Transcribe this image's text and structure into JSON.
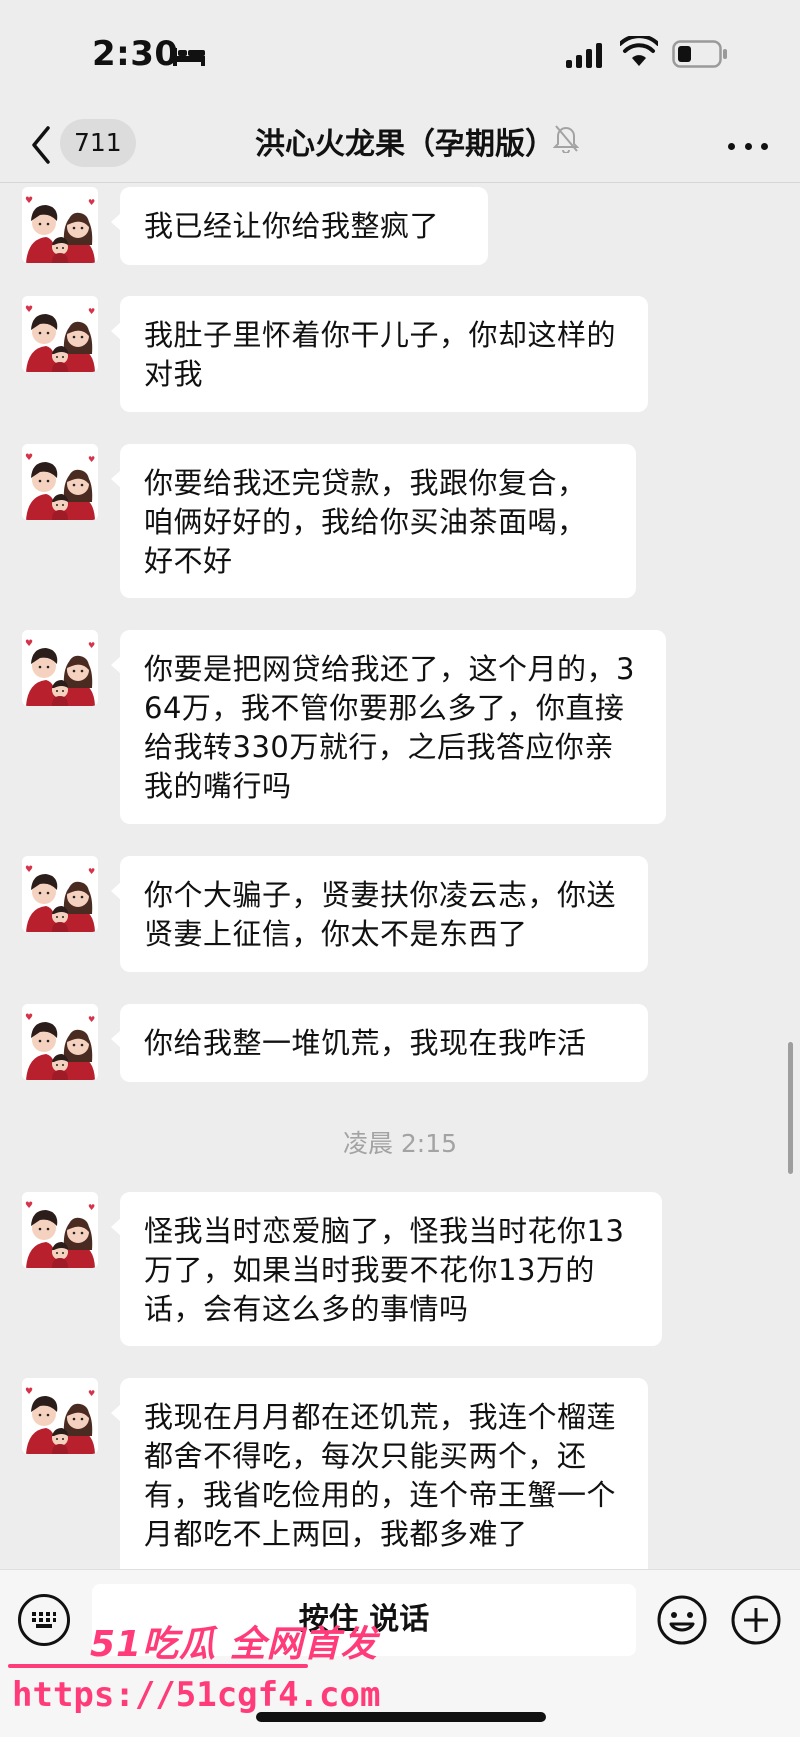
{
  "status_bar": {
    "time": "2:30"
  },
  "header": {
    "back_count": "711",
    "title": "洪心火龙果（孕期版）"
  },
  "messages": [
    {
      "text": "我已经让你给我整疯了"
    },
    {
      "text": "我肚子里怀着你干儿子，你却这样的对我"
    },
    {
      "text": "你要给我还完贷款，我跟你复合，咱俩好好的，我给你买油茶面喝，好不好"
    },
    {
      "text": "你要是把网贷给我还了，这个月的，364万，我不管你要那么多了，你直接给我转330万就行，之后我答应你亲我的嘴行吗"
    },
    {
      "text": "你个大骗子，贤妻扶你凌云志，你送贤妻上征信，你太不是东西了"
    },
    {
      "text": "你给我整一堆饥荒，我现在我咋活"
    },
    {
      "text": "怪我当时恋爱脑了，怪我当时花你13万了，如果当时我要不花你13万的话，会有这么多的事情吗"
    },
    {
      "text": "我现在月月都在还饥荒，我连个榴莲都舍不得吃，每次只能买两个，还有，我省吃俭用的，连个帝王蟹一个月都吃不上两回，我都多难了"
    }
  ],
  "time_divider": "凌晨 2:15",
  "input_bar": {
    "voice_label": "按住 说话"
  },
  "watermark": {
    "brand": "51吃瓜 全网首发",
    "url": "https://51cgf4.com"
  },
  "icons": {
    "back": "chevron-left-icon",
    "mute": "bell-slash-icon",
    "more": "more-icon",
    "keyboard": "keyboard-icon",
    "emoji": "emoji-icon",
    "plus": "plus-icon"
  }
}
